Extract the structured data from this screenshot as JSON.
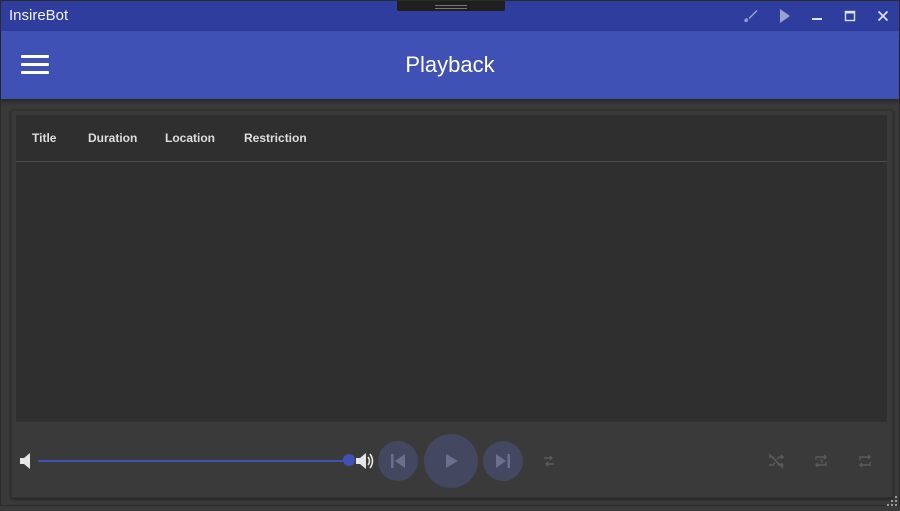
{
  "window": {
    "app_title": "InsireBot",
    "buttons": [
      "paint-brush-icon",
      "play-icon",
      "minimize-icon",
      "maximize-icon",
      "close-icon"
    ]
  },
  "appbar": {
    "title": "Playback",
    "menu_icon": "hamburger-menu-icon"
  },
  "table": {
    "columns": [
      "Title",
      "Duration",
      "Location",
      "Restriction"
    ],
    "rows": []
  },
  "player": {
    "volume_level": 1.0,
    "icons": {
      "volume_low": "volume-low-icon",
      "volume_high": "volume-high-icon",
      "previous": "skip-previous-icon",
      "play": "play-icon",
      "next": "skip-next-icon",
      "queue": "swap-icon",
      "shuffle": "shuffle-disabled-icon",
      "repeat_one": "repeat-icon",
      "repeat": "repeat-icon"
    }
  },
  "colors": {
    "titlebar": "#2f3e9e",
    "appbar": "#3f51b5",
    "background": "#3a3a3a",
    "table_bg": "#2f2f2f",
    "accent": "#3f51b5"
  }
}
